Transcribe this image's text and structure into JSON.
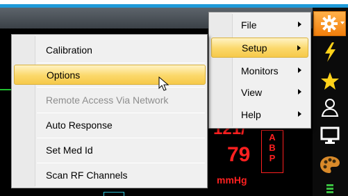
{
  "background": {
    "vitals": {
      "top_value": "121/",
      "mid_value": "79",
      "unit": "mmHg",
      "label_letters": [
        "A",
        "B",
        "P"
      ]
    },
    "accent_blue": "#1e9ad9",
    "alarm_red": "#ff2020"
  },
  "toolbar": {
    "buttons": [
      "gear-icon",
      "lightning-icon",
      "star-icon",
      "user-icon",
      "monitor-icon",
      "palette-icon",
      "bars-icon"
    ]
  },
  "main_menu": {
    "items": [
      {
        "label": "File",
        "has_submenu": true
      },
      {
        "label": "Setup",
        "has_submenu": true,
        "highlighted": true
      },
      {
        "label": "Monitors",
        "has_submenu": true
      },
      {
        "label": "View",
        "has_submenu": true
      },
      {
        "label": "Help",
        "has_submenu": true
      }
    ]
  },
  "setup_submenu": {
    "items": [
      {
        "label": "Calibration"
      },
      {
        "label": "Options",
        "highlighted": true
      },
      {
        "label": "Remote Access Via Network",
        "disabled": true
      },
      {
        "label": "Auto Response"
      },
      {
        "label": "Set Med Id"
      },
      {
        "label": "Scan RF Channels"
      }
    ]
  }
}
